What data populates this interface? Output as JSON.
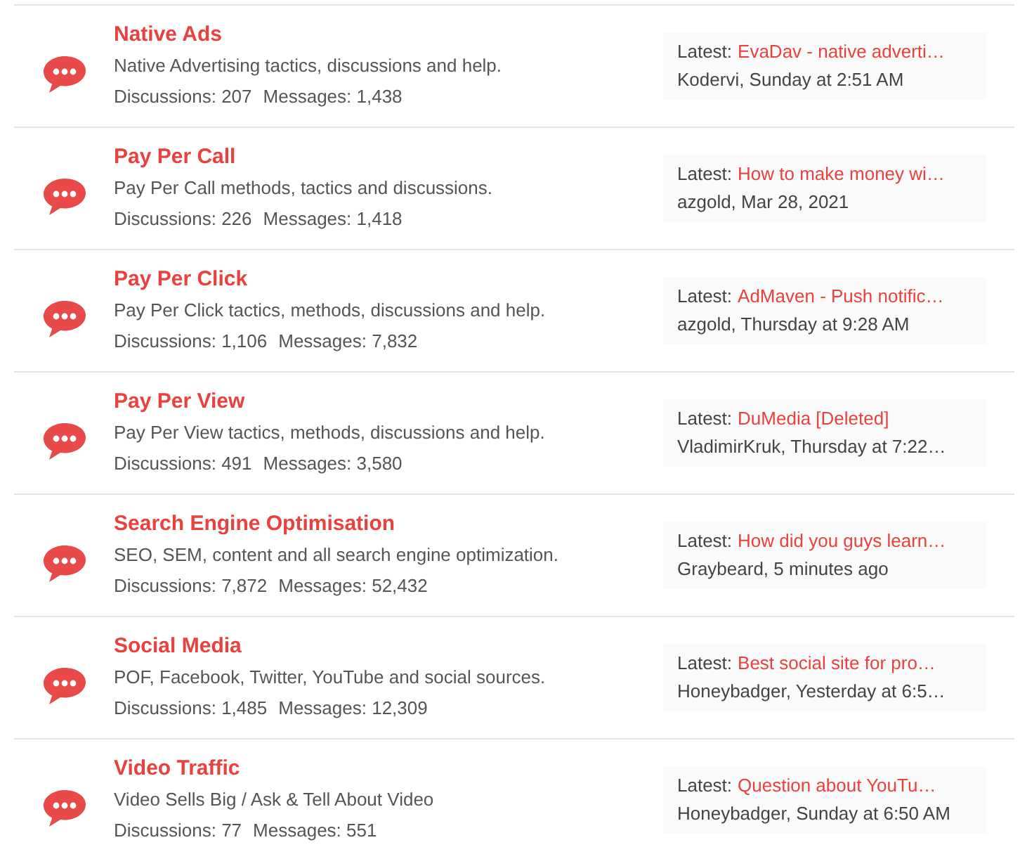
{
  "forums": [
    {
      "title": "Native Ads",
      "description": "Native Advertising tactics, discussions and help.",
      "discussions": "Discussions: 207",
      "messages": "Messages: 1,438",
      "latest_label": "Latest:",
      "latest_thread": "EvaDav - native adverti…",
      "latest_meta": "Kodervi, Sunday at 2:51 AM"
    },
    {
      "title": "Pay Per Call",
      "description": "Pay Per Call methods, tactics and discussions.",
      "discussions": "Discussions: 226",
      "messages": "Messages: 1,418",
      "latest_label": "Latest:",
      "latest_thread": "How to make money wi…",
      "latest_meta": "azgold, Mar 28, 2021"
    },
    {
      "title": "Pay Per Click",
      "description": "Pay Per Click tactics, methods, discussions and help.",
      "discussions": "Discussions: 1,106",
      "messages": "Messages: 7,832",
      "latest_label": "Latest:",
      "latest_thread": "AdMaven - Push notific…",
      "latest_meta": "azgold, Thursday at 9:28 AM"
    },
    {
      "title": "Pay Per View",
      "description": "Pay Per View tactics, methods, discussions and help.",
      "discussions": "Discussions: 491",
      "messages": "Messages: 3,580",
      "latest_label": "Latest:",
      "latest_thread": "DuMedia [Deleted]",
      "latest_meta": "VladimirKruk, Thursday at 7:22…"
    },
    {
      "title": "Search Engine Optimisation",
      "description": "SEO, SEM, content and all search engine optimization.",
      "discussions": "Discussions: 7,872",
      "messages": "Messages: 52,432",
      "latest_label": "Latest:",
      "latest_thread": "How did you guys learn…",
      "latest_meta": "Graybeard, 5 minutes ago"
    },
    {
      "title": "Social Media",
      "description": "POF, Facebook, Twitter, YouTube and social sources.",
      "discussions": "Discussions: 1,485",
      "messages": "Messages: 12,309",
      "latest_label": "Latest:",
      "latest_thread": "Best social site for pro…",
      "latest_meta": "Honeybadger, Yesterday at 6:5…"
    },
    {
      "title": "Video Traffic",
      "description": "Video Sells Big / Ask & Tell About Video",
      "discussions": "Discussions: 77",
      "messages": "Messages: 551",
      "latest_label": "Latest:",
      "latest_thread": "Question about YouTu…",
      "latest_meta": "Honeybadger, Sunday at 6:50 AM"
    }
  ]
}
